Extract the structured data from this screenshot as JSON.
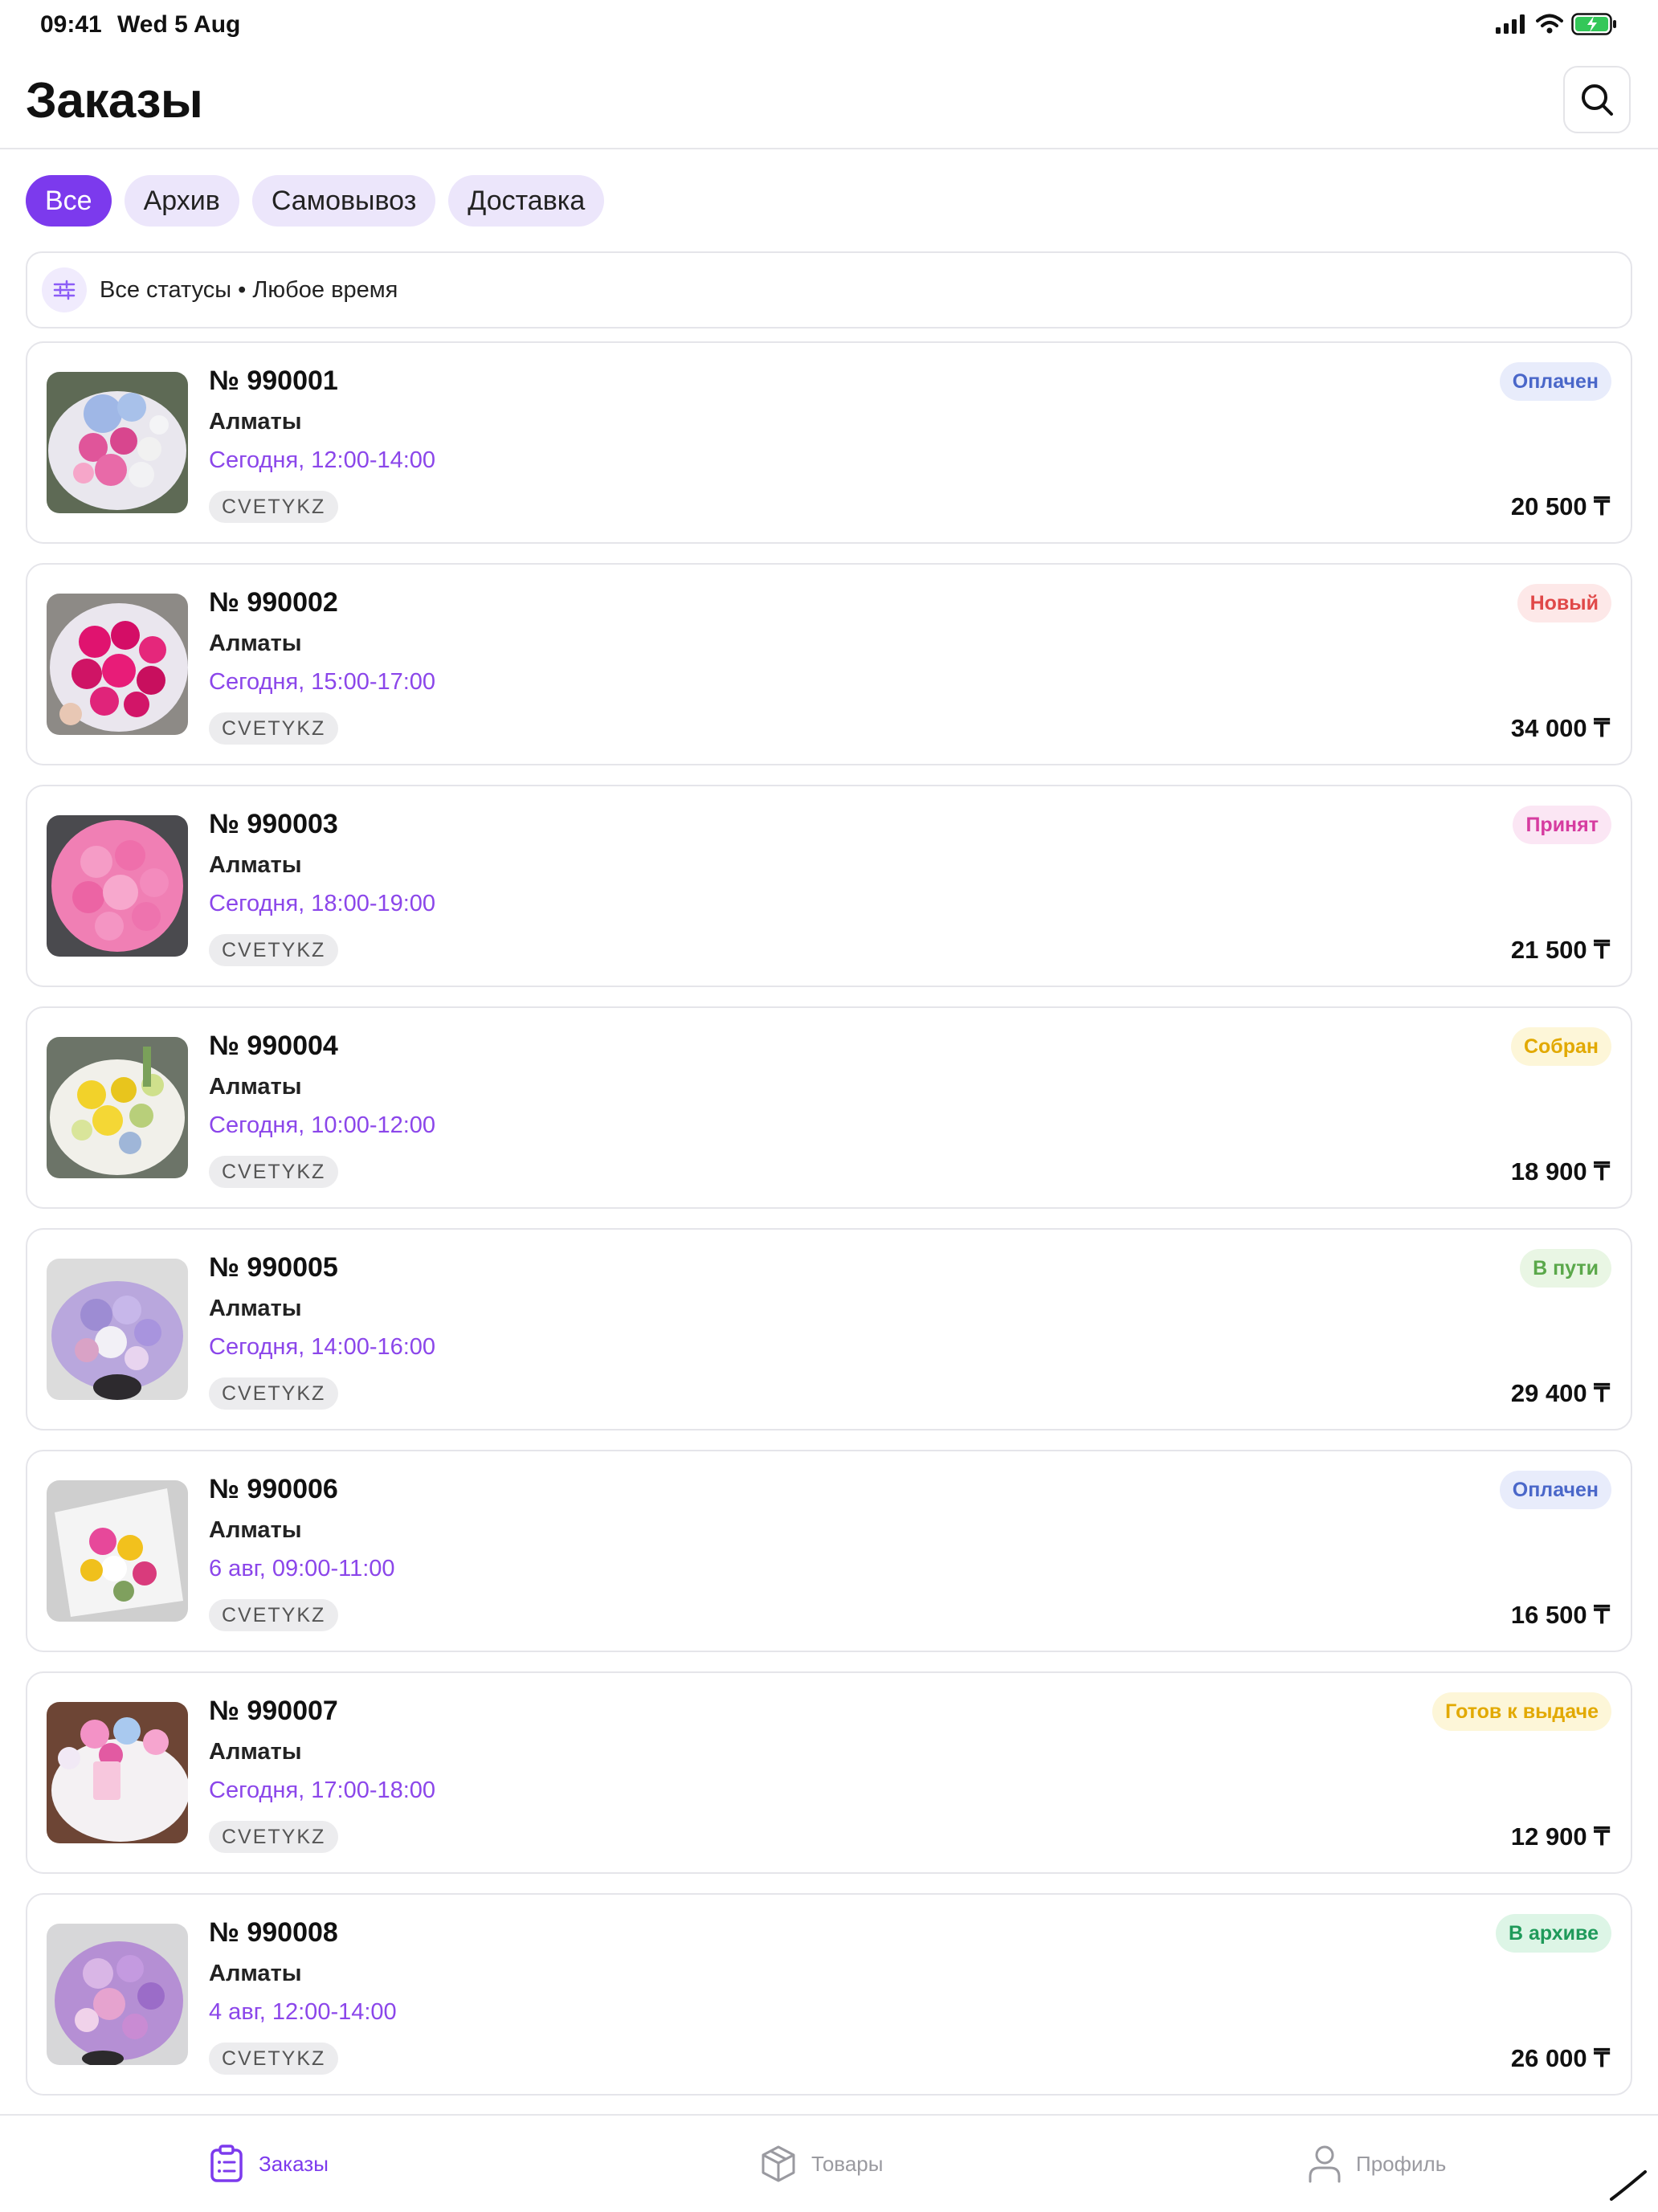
{
  "status_bar": {
    "time": "09:41",
    "date": "Wed 5 Aug"
  },
  "header": {
    "title": "Заказы",
    "search_icon": "search-icon"
  },
  "tabs": [
    {
      "label": "Все",
      "active": true
    },
    {
      "label": "Архив",
      "active": false
    },
    {
      "label": "Самовывоз",
      "active": false
    },
    {
      "label": "Доставка",
      "active": false
    }
  ],
  "filter": {
    "text": "Все статусы • Любое время",
    "icon": "sliders-icon"
  },
  "orders": [
    {
      "number": "№ 990001",
      "city": "Алматы",
      "time": "Сегодня, 12:00-14:00",
      "shop": "CVETYKZ",
      "status": "Оплачен",
      "price": "20 500 ₸"
    },
    {
      "number": "№ 990002",
      "city": "Алматы",
      "time": "Сегодня, 15:00-17:00",
      "shop": "CVETYKZ",
      "status": "Новый",
      "price": "34 000 ₸"
    },
    {
      "number": "№ 990003",
      "city": "Алматы",
      "time": "Сегодня, 18:00-19:00",
      "shop": "CVETYKZ",
      "status": "Принят",
      "price": "21 500 ₸"
    },
    {
      "number": "№ 990004",
      "city": "Алматы",
      "time": "Сегодня, 10:00-12:00",
      "shop": "CVETYKZ",
      "status": "Собран",
      "price": "18 900 ₸"
    },
    {
      "number": "№ 990005",
      "city": "Алматы",
      "time": "Сегодня, 14:00-16:00",
      "shop": "CVETYKZ",
      "status": "В пути",
      "price": "29 400 ₸"
    },
    {
      "number": "№ 990006",
      "city": "Алматы",
      "time": "6 авг, 09:00-11:00",
      "shop": "CVETYKZ",
      "status": "Оплачен",
      "price": "16 500 ₸"
    },
    {
      "number": "№ 990007",
      "city": "Алматы",
      "time": "Сегодня, 17:00-18:00",
      "shop": "CVETYKZ",
      "status": "Готов к выдаче",
      "price": "12 900 ₸"
    },
    {
      "number": "№ 990008",
      "city": "Алматы",
      "time": "4 авг, 12:00-14:00",
      "shop": "CVETYKZ",
      "status": "В архиве",
      "price": "26 000 ₸"
    }
  ],
  "bottom_nav": [
    {
      "label": "Заказы",
      "icon": "clipboard-icon",
      "active": true
    },
    {
      "label": "Товары",
      "icon": "box-icon",
      "active": false
    },
    {
      "label": "Профиль",
      "icon": "user-icon",
      "active": false
    }
  ],
  "colors": {
    "accent": "#7c3aed",
    "accent_light": "#ece6fb",
    "time_text": "#8b46ea",
    "status_paid": "#4a67c9",
    "status_new": "#e04848",
    "status_accepted": "#d63ca0",
    "status_assembled": "#e2a900",
    "status_on_way": "#5aa84a",
    "status_ready": "#e2a900",
    "status_archived": "#1f9a5a"
  }
}
